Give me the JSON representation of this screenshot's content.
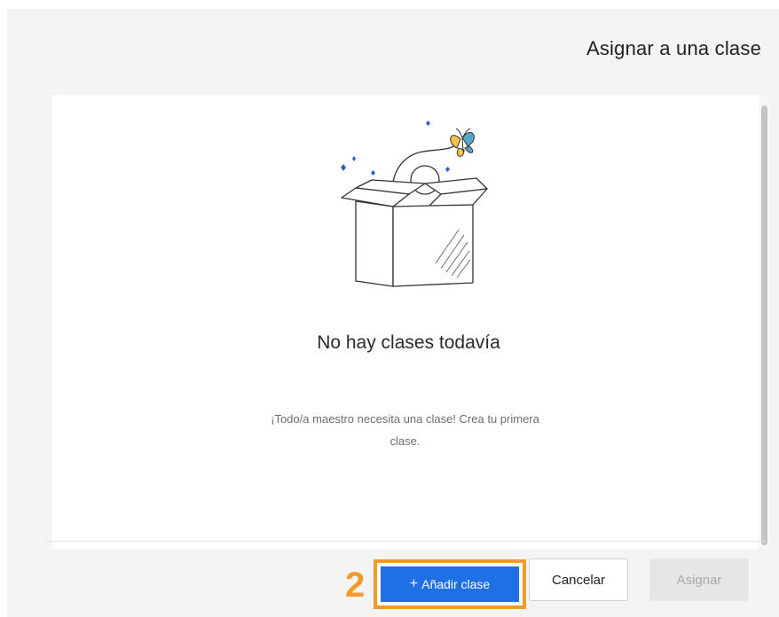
{
  "dialog": {
    "title": "Asignar a una clase"
  },
  "empty_state": {
    "title": "No hay clases todavía",
    "message": "¡Todo/a maestro necesita una clase! Crea tu primera clase.",
    "illustration": "open-box-butterfly-icon"
  },
  "add_class_button": {
    "icon": "+",
    "label": "Añadir clase"
  },
  "annotation": {
    "step_number": "2",
    "color": "#f39a2b"
  },
  "footer": {
    "cancel_label": "Cancelar",
    "assign_label": "Asignar"
  },
  "colors": {
    "primary": "#1f6fe6",
    "background": "#f4f4f4",
    "disabled": "#e6e6e6"
  }
}
